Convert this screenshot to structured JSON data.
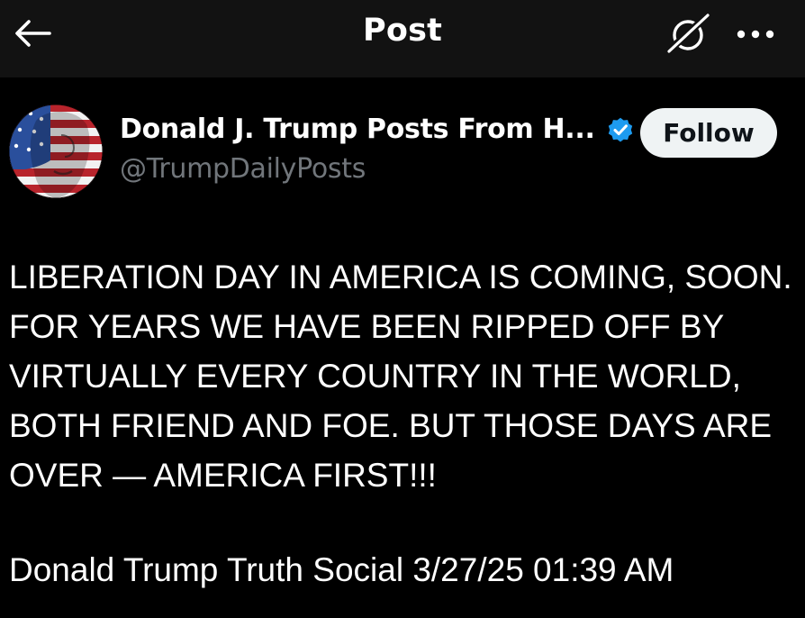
{
  "header": {
    "title": "Post",
    "back_icon": "arrow-left-icon",
    "grok_icon": "grok-icon",
    "more_icon": "more-horizontal-icon"
  },
  "post": {
    "author": {
      "display_name": "Donald J. Trump Posts From H...",
      "handle": "@TrumpDailyPosts",
      "verified": true,
      "verified_icon": "verified-badge-icon",
      "avatar_icon": "flag-portrait-avatar"
    },
    "follow_label": "Follow",
    "text": "LIBERATION DAY IN AMERICA IS COMING, SOON. FOR YEARS WE HAVE BEEN RIPPED OFF BY VIRTUALLY EVERY COUNTRY IN THE WORLD, BOTH FRIEND AND FOE. BUT THOSE DAYS ARE OVER — AMERICA FIRST!!!",
    "source_line": "Donald Trump Truth Social 3/27/25 01:39 AM"
  },
  "colors": {
    "background": "#000000",
    "header_background": "#121212",
    "text_primary": "#ffffff",
    "text_secondary": "#71767b",
    "verified_blue": "#1d9bf0",
    "follow_button_bg": "#eff3f4",
    "follow_button_text": "#0f1419"
  }
}
